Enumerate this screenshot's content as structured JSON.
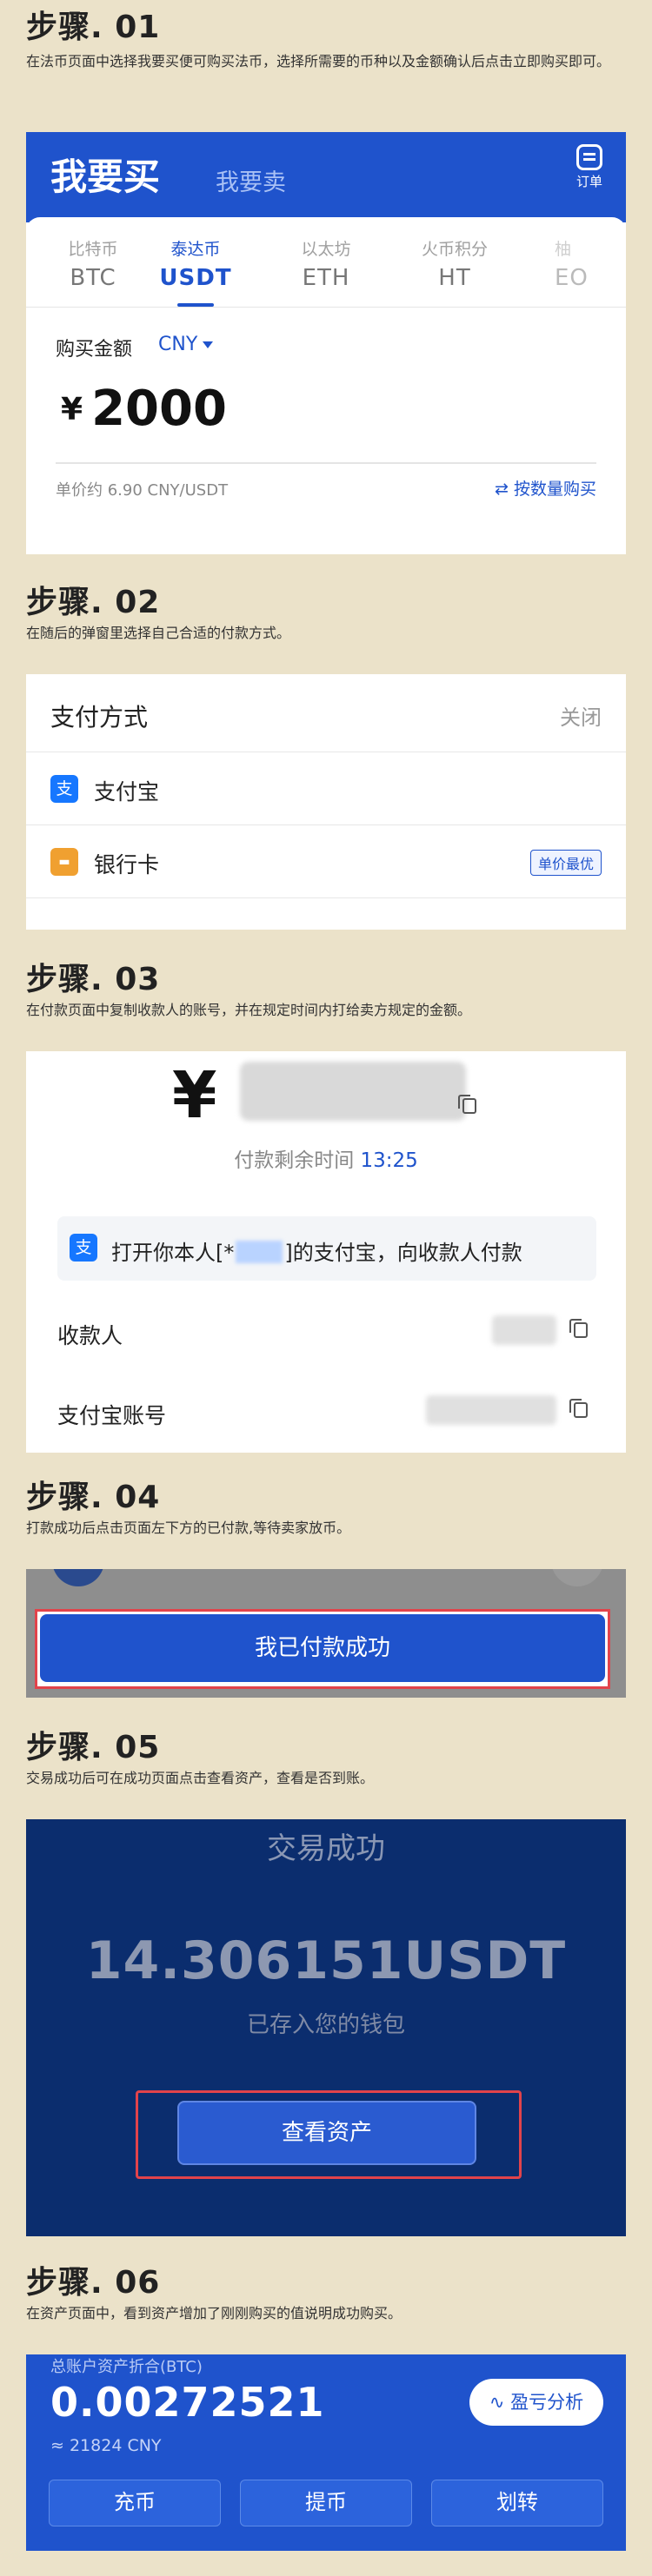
{
  "steps": [
    {
      "title": "步骤. 01",
      "desc": "在法币页面中选择我要买便可购买法币，选择所需要的币种以及金额确认后点击立即购买即可。"
    },
    {
      "title": "步骤. 02",
      "desc": "在随后的弹窗里选择自己合适的付款方式。"
    },
    {
      "title": "步骤. 03",
      "desc": "在付款页面中复制收款人的账号，并在规定时间内打给卖方规定的金额。"
    },
    {
      "title": "步骤. 04",
      "desc": "打款成功后点击页面左下方的已付款,等待卖家放币。"
    },
    {
      "title": "步骤. 05",
      "desc": "交易成功后可在成功页面点击查看资产，查看是否到账。"
    },
    {
      "title": "步骤. 06",
      "desc": "在资产页面中，看到资产增加了刚刚购买的值说明成功购买。"
    }
  ],
  "buy_screen": {
    "buy_tab": "我要买",
    "sell_tab": "我要卖",
    "order_label": "订单",
    "coins": [
      {
        "cn": "比特币",
        "sym": "BTC"
      },
      {
        "cn": "泰达币",
        "sym": "USDT"
      },
      {
        "cn": "以太坊",
        "sym": "ETH"
      },
      {
        "cn": "火币积分",
        "sym": "HT"
      },
      {
        "cn": "柚",
        "sym": "EO"
      }
    ],
    "amount_label": "购买金额",
    "currency": "CNY",
    "yen": "¥",
    "amount": "2000",
    "unit_price": "单价约 6.90 CNY/USDT",
    "by_quantity": "⇄ 按数量购买"
  },
  "payment_sheet": {
    "title": "支付方式",
    "close": "关闭",
    "methods": [
      {
        "icon": "支",
        "name": "支付宝",
        "color": "#1677ff",
        "badge": ""
      },
      {
        "icon": "▬",
        "name": "银行卡",
        "color": "#f0a030",
        "badge": "单价最优"
      }
    ]
  },
  "pay_screen": {
    "yen": "¥",
    "countdown_label": "付款剩余时间",
    "countdown": "13:25",
    "notice_icon": "支",
    "notice_before": "打开你本人[*",
    "notice_after": "]的支付宝，向收款人付款",
    "payee_label": "收款人",
    "account_label": "支付宝账号"
  },
  "paid_screen": {
    "button": "我已付款成功"
  },
  "success_screen": {
    "title": "交易成功",
    "amount": "14.306151USDT",
    "subtitle": "已存入您的钱包",
    "button": "查看资产"
  },
  "assets_screen": {
    "total_label": "总账户资产折合(BTC)",
    "total_value": "0.00272521",
    "total_cny": "≈ 21824  CNY",
    "analysis": "∿ 盈亏分析",
    "actions": [
      "充币",
      "提币",
      "划转"
    ]
  },
  "colors": {
    "brand_blue": "#1f53cc",
    "highlight_red": "#e2434b",
    "background": "#ebe2c9"
  }
}
